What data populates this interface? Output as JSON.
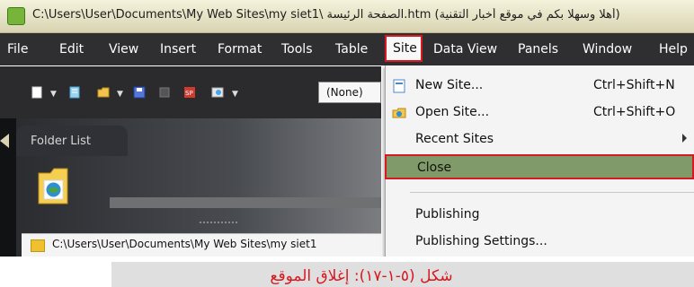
{
  "window": {
    "title": "C:\\Users\\User\\Documents\\My Web Sites\\my siet1\\ الصفحة الرئيسة.htm (أهلا وسهلا بكم في موقع أخبار التقنية)"
  },
  "menubar": {
    "items": [
      "File",
      "Edit",
      "View",
      "Insert",
      "Format",
      "Tools",
      "Table",
      "Site",
      "Data View",
      "Panels",
      "Window",
      "Help"
    ]
  },
  "toolbar": {
    "style_value": "(None)"
  },
  "folder_list": {
    "title": "Folder List",
    "path": "C:\\Users\\User\\Documents\\My Web Sites\\my siet1"
  },
  "site_menu": {
    "items": [
      {
        "label": "New Site...",
        "shortcut": "Ctrl+Shift+N",
        "icon": "new-site-icon"
      },
      {
        "label": "Open Site...",
        "shortcut": "Ctrl+Shift+O",
        "icon": "open-site-icon"
      },
      {
        "label": "Recent Sites",
        "shortcut": "",
        "icon": "submenu-arrow-icon"
      },
      {
        "label": "Close",
        "shortcut": "",
        "icon": ""
      },
      {
        "label": "Publishing",
        "shortcut": "",
        "icon": ""
      },
      {
        "label": "Publishing Settings...",
        "shortcut": "",
        "icon": ""
      }
    ]
  },
  "caption": {
    "text": "شكل (٥-١-١٧): إغلاق الموقع"
  },
  "colors": {
    "dark_ui": "#2f2f31",
    "menu_bg": "#f4f4f4",
    "selected_green": "#809b69",
    "highlight_red": "#d71920",
    "caption_gray": "#dfdfdf"
  }
}
